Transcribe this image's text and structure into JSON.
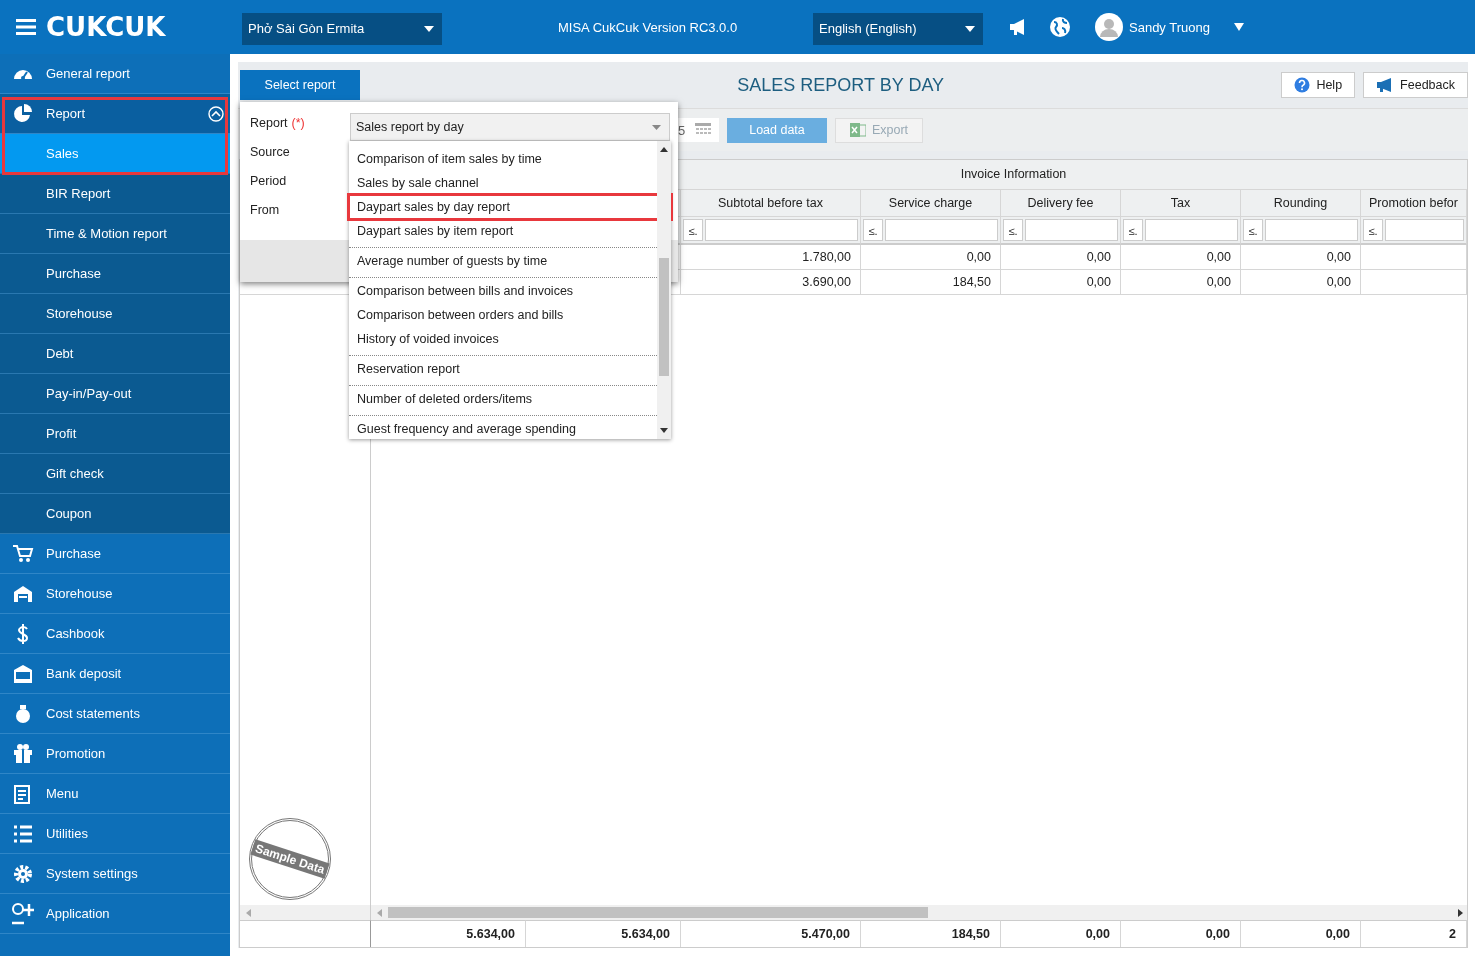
{
  "topbar": {
    "logo": "CUKCUK",
    "restaurant": "Phở Sài Gòn Ermita",
    "version": "MISA CukCuk Version RC3.0.0",
    "language": "English (English)",
    "user": "Sandy Truong"
  },
  "sidebar": {
    "items": [
      {
        "label": "General report",
        "kind": "dashboard",
        "selected": false
      },
      {
        "label": "Report",
        "kind": "pie",
        "selected": false,
        "expanded": true,
        "annotated": true,
        "children": [
          {
            "label": "Sales",
            "selected": true
          },
          {
            "label": "BIR Report",
            "selected": false
          },
          {
            "label": "Time & Motion report",
            "selected": false
          },
          {
            "label": "Purchase",
            "selected": false
          },
          {
            "label": "Storehouse",
            "selected": false
          },
          {
            "label": "Debt",
            "selected": false
          },
          {
            "label": "Pay-in/Pay-out",
            "selected": false
          },
          {
            "label": "Profit",
            "selected": false
          },
          {
            "label": "Gift check",
            "selected": false
          },
          {
            "label": "Coupon",
            "selected": false
          }
        ]
      },
      {
        "label": "Purchase",
        "kind": "cart",
        "selected": false
      },
      {
        "label": "Storehouse",
        "kind": "store",
        "selected": false
      },
      {
        "label": "Cashbook",
        "kind": "dollar",
        "selected": false
      },
      {
        "label": "Bank deposit",
        "kind": "bank",
        "selected": false
      },
      {
        "label": "Cost statements",
        "kind": "money",
        "selected": false
      },
      {
        "label": "Promotion",
        "kind": "gift",
        "selected": false
      },
      {
        "label": "Menu",
        "kind": "clipboard",
        "selected": false
      },
      {
        "label": "Utilities",
        "kind": "list",
        "selected": false
      },
      {
        "label": "System settings",
        "kind": "gear",
        "selected": false
      },
      {
        "label": "Application",
        "kind": "app",
        "selected": false
      }
    ]
  },
  "report": {
    "tab": "Select report",
    "title": "SALES REPORT BY DAY",
    "help": "Help",
    "feedback": "Feedback",
    "toolbar": {
      "date_fragment": "5",
      "load": "Load data",
      "export": "Export",
      "export_disabled": true
    },
    "table": {
      "group_header": "Invoice Information",
      "columns": [
        {
          "stamp": "Sample Data"
        },
        {
          "total": "5.634,00"
        },
        {
          "total": "5.634,00"
        },
        {
          "header": "Subtotal before tax",
          "filter": "≤.",
          "cells": [
            "1.780,00",
            "3.690,00"
          ],
          "total": "5.470,00"
        },
        {
          "header": "Service charge",
          "filter": "≤.",
          "cells": [
            "0,00",
            "184,50"
          ],
          "total": "184,50"
        },
        {
          "header": "Delivery fee",
          "filter": "≤.",
          "cells": [
            "0,00",
            "0,00"
          ],
          "total": "0,00"
        },
        {
          "header": "Tax",
          "filter": "≤.",
          "cells": [
            "0,00",
            "0,00"
          ],
          "total": "0,00"
        },
        {
          "header": "Rounding",
          "filter": "≤.",
          "cells": [
            "0,00",
            "0,00"
          ],
          "total": "0,00"
        },
        {
          "header": "Promotion befor",
          "filter": "≤.",
          "total": "2"
        }
      ]
    }
  },
  "popup": {
    "fields": [
      {
        "label": "Report",
        "required": "(*)"
      },
      {
        "label": "Source"
      },
      {
        "label": "Period"
      },
      {
        "label": "From"
      }
    ],
    "select": {
      "value": "Sales report by day"
    },
    "options": [
      {
        "label": "Comparison of item sales by time",
        "annotated": false,
        "separator_after": false
      },
      {
        "label": "Sales by sale channel",
        "annotated": false,
        "separator_after": false
      },
      {
        "label": "Daypart sales by day report",
        "annotated": true,
        "separator_after": false
      },
      {
        "label": "Daypart sales by item report",
        "annotated": false,
        "separator_after": true
      },
      {
        "label": "Average number of guests by time",
        "annotated": false,
        "separator_after": true
      },
      {
        "label": "Comparison between bills and invoices",
        "annotated": false,
        "separator_after": false
      },
      {
        "label": "Comparison between orders and bills",
        "annotated": false,
        "separator_after": false
      },
      {
        "label": "History of voided invoices",
        "annotated": false,
        "separator_after": true
      },
      {
        "label": "Reservation report",
        "annotated": false,
        "separator_after": true
      },
      {
        "label": "Number of deleted orders/items",
        "annotated": false,
        "separator_after": true
      },
      {
        "label": "Guest frequency and average spending",
        "annotated": false,
        "separator_after": false
      }
    ]
  }
}
